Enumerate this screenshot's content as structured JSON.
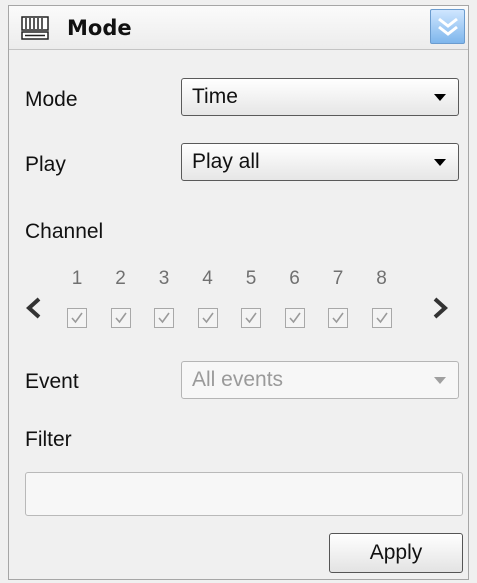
{
  "panel": {
    "title": "Mode",
    "title_icon": "keyboard-icon",
    "collapse_icon": "double-chevron-down-icon"
  },
  "mode": {
    "label": "Mode",
    "value": "Time"
  },
  "play": {
    "label": "Play",
    "value": "Play all"
  },
  "channel": {
    "label": "Channel",
    "numbers": [
      "1",
      "2",
      "3",
      "4",
      "5",
      "6",
      "7",
      "8"
    ],
    "checked": [
      true,
      true,
      true,
      true,
      true,
      true,
      true,
      true
    ]
  },
  "event": {
    "label": "Event",
    "value": "All events"
  },
  "filter": {
    "label": "Filter",
    "value": ""
  },
  "actions": {
    "apply_label": "Apply"
  },
  "colors": {
    "accent": "#7eb6ec",
    "disabled_text": "#9a9a9a"
  }
}
